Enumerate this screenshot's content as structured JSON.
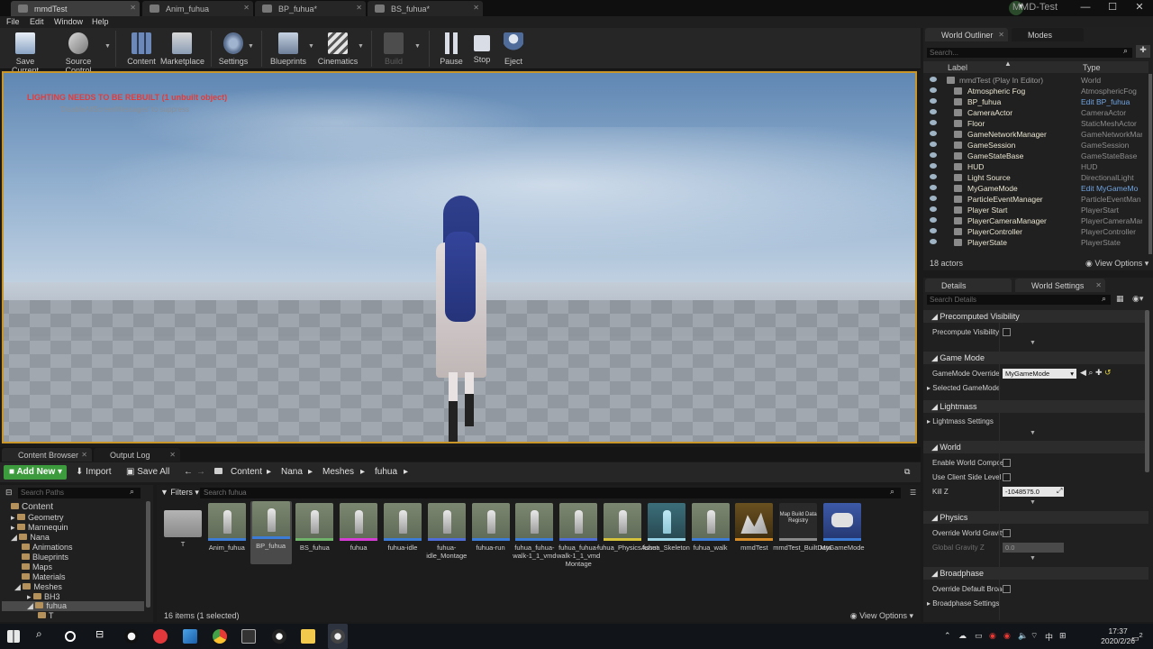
{
  "window": {
    "title": "MMD-Test",
    "tabs": [
      {
        "label": "mmdTest",
        "active": true
      },
      {
        "label": "Anim_fuhua",
        "active": false
      },
      {
        "label": "BP_fuhua*",
        "active": false
      },
      {
        "label": "BS_fuhua*",
        "active": false
      }
    ]
  },
  "menu": [
    "File",
    "Edit",
    "Window",
    "Help"
  ],
  "toolbar": {
    "save_current": "Save Current",
    "source_control": "Source Control",
    "content": "Content",
    "marketplace": "Marketplace",
    "settings": "Settings",
    "blueprints": "Blueprints",
    "cinematics": "Cinematics",
    "build": "Build",
    "pause": "Pause",
    "stop": "Stop",
    "eject": "Eject"
  },
  "viewport": {
    "warning": "LIGHTING NEEDS TO BE REBUILT (1 unbuilt object)",
    "suppress": "'DisableAllScreenMessages' to suppress"
  },
  "content_browser": {
    "tabs": [
      "Content Browser",
      "Output Log"
    ],
    "add_new": "Add New",
    "import": "Import",
    "save_all": "Save All",
    "breadcrumb": [
      "Content",
      "Nana",
      "Meshes",
      "fuhua"
    ],
    "search_paths_placeholder": "Search Paths",
    "filters": "Filters",
    "search_placeholder": "Search fuhua",
    "tree": [
      {
        "label": "Content",
        "level": 0
      },
      {
        "label": "Geometry",
        "level": 1
      },
      {
        "label": "Mannequin",
        "level": 1
      },
      {
        "label": "Nana",
        "level": 1
      },
      {
        "label": "Animations",
        "level": 2
      },
      {
        "label": "Blueprints",
        "level": 2
      },
      {
        "label": "Maps",
        "level": 2
      },
      {
        "label": "Materials",
        "level": 2
      },
      {
        "label": "Meshes",
        "level": 2
      },
      {
        "label": "BH3",
        "level": 3
      },
      {
        "label": "fuhua",
        "level": 3
      },
      {
        "label": "T",
        "level": 4
      }
    ],
    "assets": [
      {
        "label": "T",
        "type": "folder"
      },
      {
        "label": "Anim_fuhua",
        "bar": "#3c7bd6"
      },
      {
        "label": "BP_fuhua",
        "bar": "#3c7bd6",
        "selected": true
      },
      {
        "label": "BS_fuhua",
        "bar": "#6fb36a"
      },
      {
        "label": "fuhua",
        "bar": "#d43cd4"
      },
      {
        "label": "fuhua-idle",
        "bar": "#3c7bd6"
      },
      {
        "label": "fuhua-idle_Montage",
        "bar": "#4f6dd6"
      },
      {
        "label": "fuhua-run",
        "bar": "#3c7bd6"
      },
      {
        "label": "fuhua_fuhua-walk-1_1_vmd",
        "bar": "#3c7bd6"
      },
      {
        "label": "fuhua_fuhua-walk-1_1_vmd Montage",
        "bar": "#4f6dd6"
      },
      {
        "label": "fuhua_PhysicsAsset",
        "bar": "#d4c23c"
      },
      {
        "label": "fuhua_Skeleton",
        "bar": "#9cd6e6"
      },
      {
        "label": "fuhua_walk",
        "bar": "#3c7bd6"
      },
      {
        "label": "mmdTest",
        "bar": "#d48b2a"
      },
      {
        "label": "mmdTest_BuiltData",
        "bar": "#8a8a8a",
        "thumb_text": "Map Build Data Registry"
      },
      {
        "label": "MyGameMode",
        "bar": "#3c7bd6"
      }
    ],
    "items_info": "16 items (1 selected)",
    "view_options": "View Options"
  },
  "outliner": {
    "tabs": [
      "World Outliner",
      "Modes"
    ],
    "search_placeholder": "Search...",
    "col_label": "Label",
    "col_type": "Type",
    "rows": [
      {
        "name": "mmdTest (Play In Editor)",
        "type": "World",
        "dim": true
      },
      {
        "name": "Atmospheric Fog",
        "type": "AtmosphericFog"
      },
      {
        "name": "BP_fuhua",
        "type": "Edit BP_fuhua",
        "link": true
      },
      {
        "name": "CameraActor",
        "type": "CameraActor"
      },
      {
        "name": "Floor",
        "type": "StaticMeshActor"
      },
      {
        "name": "GameNetworkManager",
        "type": "GameNetworkMar"
      },
      {
        "name": "GameSession",
        "type": "GameSession"
      },
      {
        "name": "GameStateBase",
        "type": "GameStateBase"
      },
      {
        "name": "HUD",
        "type": "HUD"
      },
      {
        "name": "Light Source",
        "type": "DirectionalLight"
      },
      {
        "name": "MyGameMode",
        "type": "Edit MyGameMo",
        "link": true
      },
      {
        "name": "ParticleEventManager",
        "type": "ParticleEventMan"
      },
      {
        "name": "Player Start",
        "type": "PlayerStart"
      },
      {
        "name": "PlayerCameraManager",
        "type": "PlayerCameraMan"
      },
      {
        "name": "PlayerController",
        "type": "PlayerController"
      },
      {
        "name": "PlayerState",
        "type": "PlayerState"
      }
    ],
    "actor_count": "18 actors",
    "view_options": "View Options"
  },
  "details": {
    "tabs": [
      "Details",
      "World Settings"
    ],
    "search_placeholder": "Search Details",
    "sections": {
      "precomputed_visibility": "Precomputed Visibility",
      "precompute_visibility": "Precompute Visibility",
      "game_mode": "Game Mode",
      "gamemode_override": "GameMode Override",
      "gamemode_value": "MyGameMode",
      "selected_gamemode": "Selected GameMode",
      "lightmass": "Lightmass",
      "lightmass_settings": "Lightmass Settings",
      "world": "World",
      "enable_world_composition": "Enable World Composi",
      "use_client_side_level": "Use Client Side Level",
      "kill_z": "Kill Z",
      "kill_z_value": "-1048575.0",
      "physics": "Physics",
      "override_world_gravity": "Override World Gravity",
      "global_gravity_z": "Global Gravity Z",
      "global_gravity_z_value": "0.0",
      "broadphase": "Broadphase",
      "override_default_broadphase": "Override Default Broac",
      "broadphase_settings": "Broadphase Settings"
    }
  },
  "taskbar": {
    "time": "17:37",
    "date": "2020/2/26",
    "ime": "中",
    "notification_count": "2"
  }
}
